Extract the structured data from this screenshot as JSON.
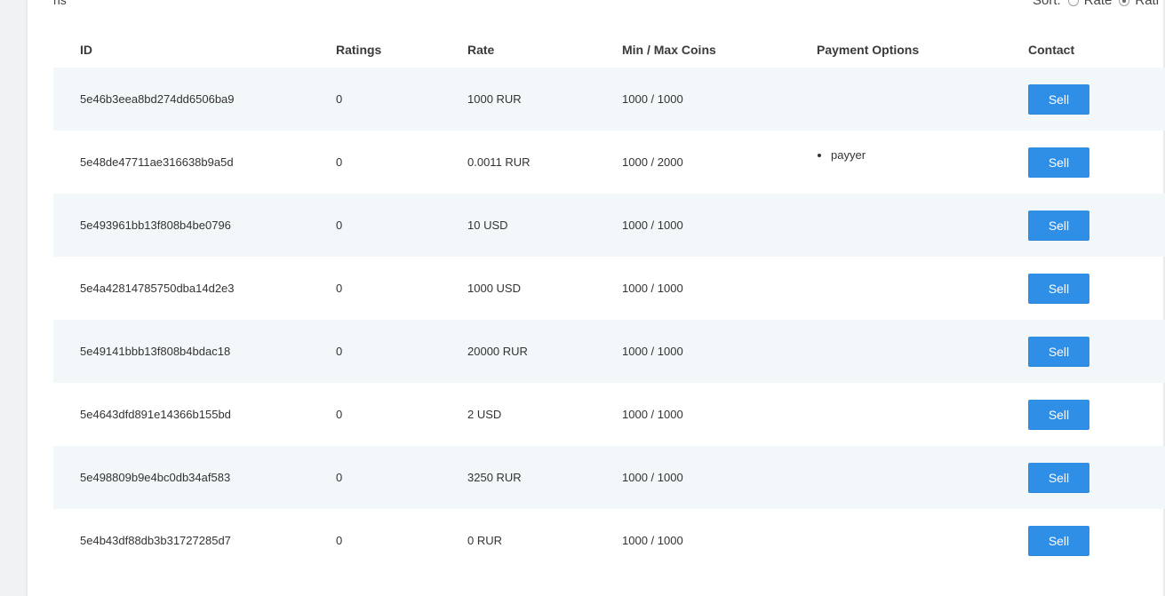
{
  "header": {
    "top_left_text": "ns",
    "sort": {
      "label": "Sort:",
      "options": [
        {
          "label": "Rate",
          "checked": false
        },
        {
          "label": "Rati",
          "checked": true
        }
      ]
    }
  },
  "table": {
    "columns": {
      "id": "ID",
      "ratings": "Ratings",
      "rate": "Rate",
      "minmax": "Min / Max Coins",
      "payment": "Payment Options",
      "contact": "Contact"
    },
    "sell_label": "Sell",
    "rows": [
      {
        "id": "5e46b3eea8bd274dd6506ba9",
        "ratings": "0",
        "rate": "1000 RUR",
        "minmax": "1000 / 1000",
        "payments": []
      },
      {
        "id": "5e48de47711ae316638b9a5d",
        "ratings": "0",
        "rate": "0.0011 RUR",
        "minmax": "1000 / 2000",
        "payments": [
          "payyer"
        ]
      },
      {
        "id": "5e493961bb13f808b4be0796",
        "ratings": "0",
        "rate": "10 USD",
        "minmax": "1000 / 1000",
        "payments": []
      },
      {
        "id": "5e4a42814785750dba14d2e3",
        "ratings": "0",
        "rate": "1000 USD",
        "minmax": "1000 / 1000",
        "payments": []
      },
      {
        "id": "5e49141bbb13f808b4bdac18",
        "ratings": "0",
        "rate": "20000 RUR",
        "minmax": "1000 / 1000",
        "payments": []
      },
      {
        "id": "5e4643dfd891e14366b155bd",
        "ratings": "0",
        "rate": "2 USD",
        "minmax": "1000 / 1000",
        "payments": []
      },
      {
        "id": "5e498809b9e4bc0db34af583",
        "ratings": "0",
        "rate": "3250 RUR",
        "minmax": "1000 / 1000",
        "payments": []
      },
      {
        "id": "5e4b43df88db3b31727285d7",
        "ratings": "0",
        "rate": "0 RUR",
        "minmax": "1000 / 1000",
        "payments": []
      }
    ]
  }
}
